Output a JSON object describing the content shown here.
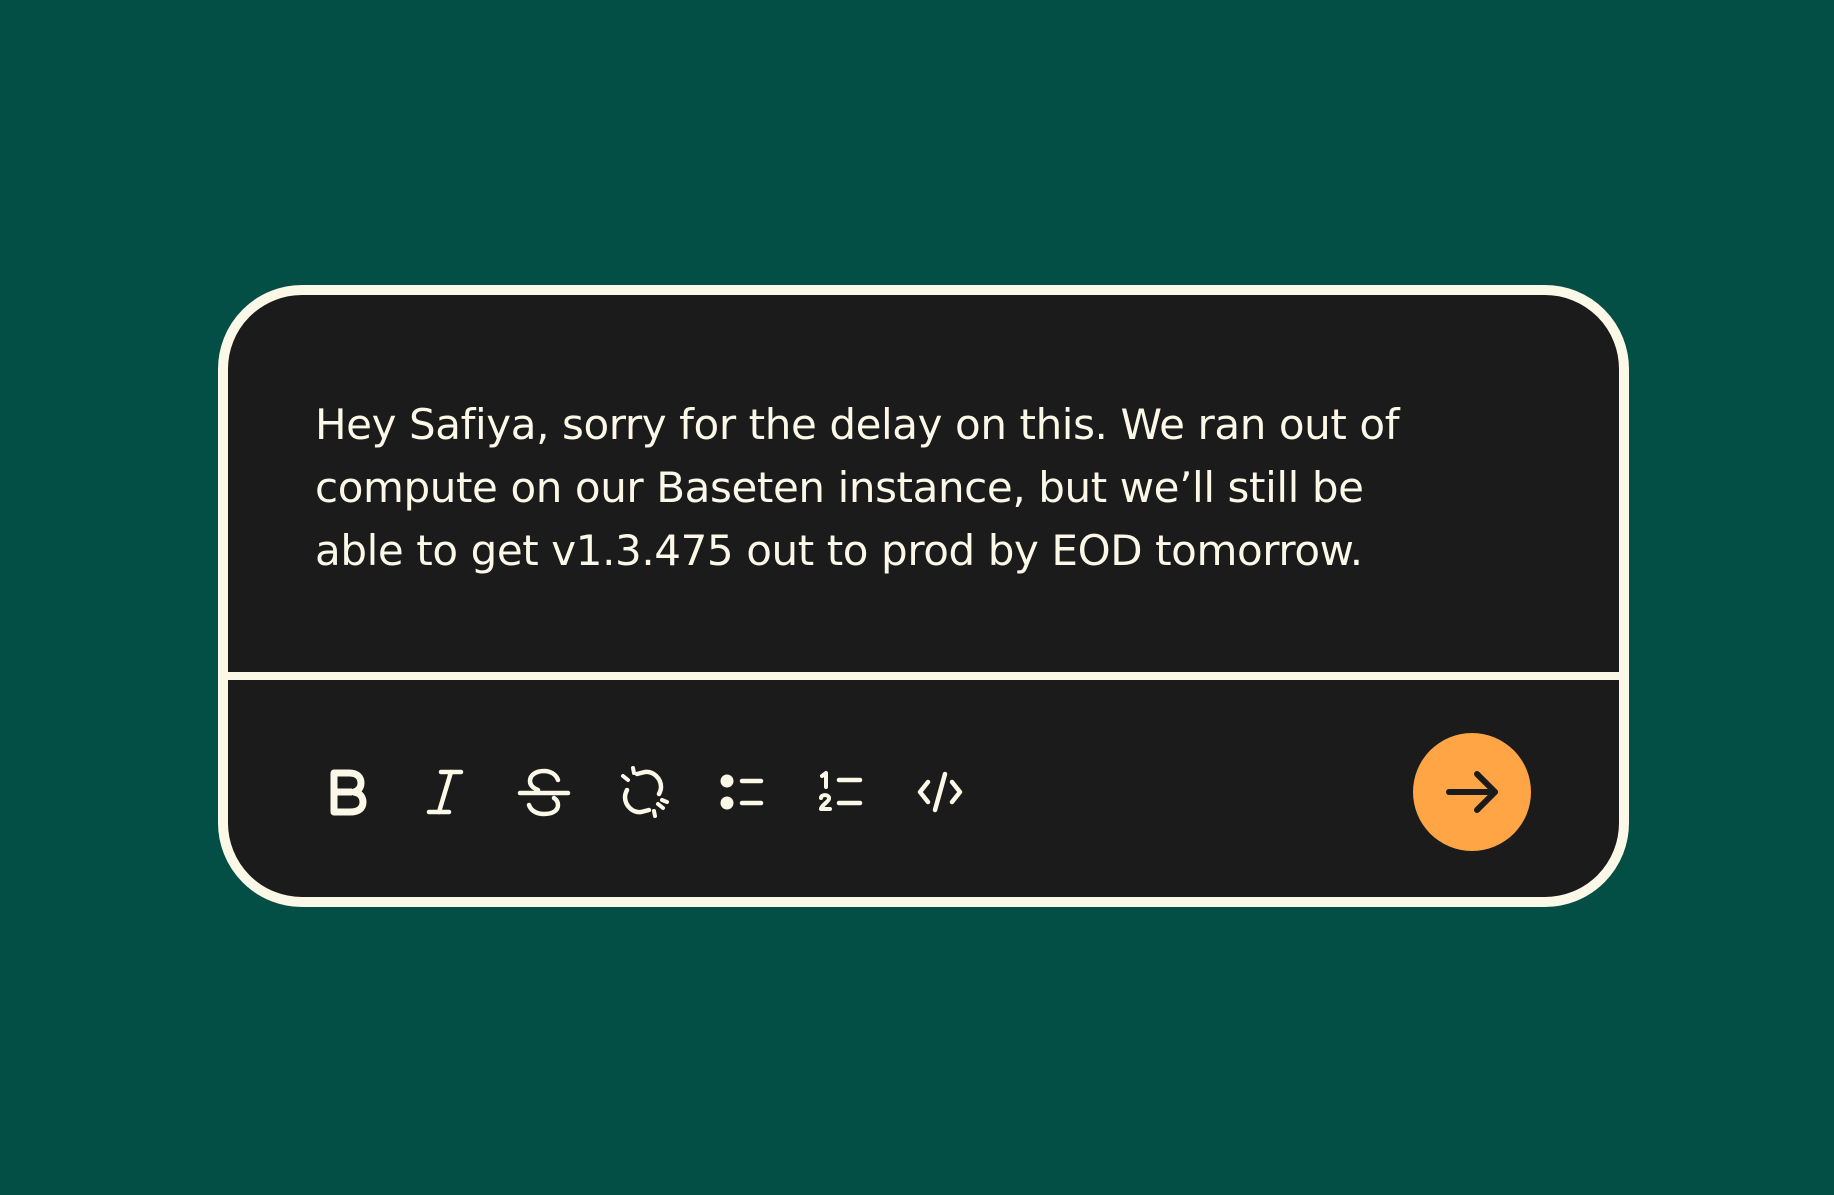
{
  "message": {
    "text": "Hey Safiya, sorry for the delay on this. We ran out of\ncompute on our Baseten instance, but we’ll still be\nable to get v1.3.475 out to prod by EOD tomorrow."
  },
  "toolbar": {
    "tools": [
      {
        "id": "bold",
        "icon": "bold-icon"
      },
      {
        "id": "italic",
        "icon": "italic-icon"
      },
      {
        "id": "strikethrough",
        "icon": "strikethrough-icon"
      },
      {
        "id": "unlink",
        "icon": "unlink-icon"
      },
      {
        "id": "bulleted-list",
        "icon": "bulleted-list-icon"
      },
      {
        "id": "numbered-list",
        "icon": "numbered-list-icon"
      },
      {
        "id": "code",
        "icon": "code-icon"
      }
    ],
    "send": {
      "icon": "arrow-right-icon"
    }
  },
  "colors": {
    "background": "#044f45",
    "panel": "#1b1b1b",
    "border": "#fbf8e8",
    "text": "#fbf8e8",
    "accent": "#ffa545"
  }
}
